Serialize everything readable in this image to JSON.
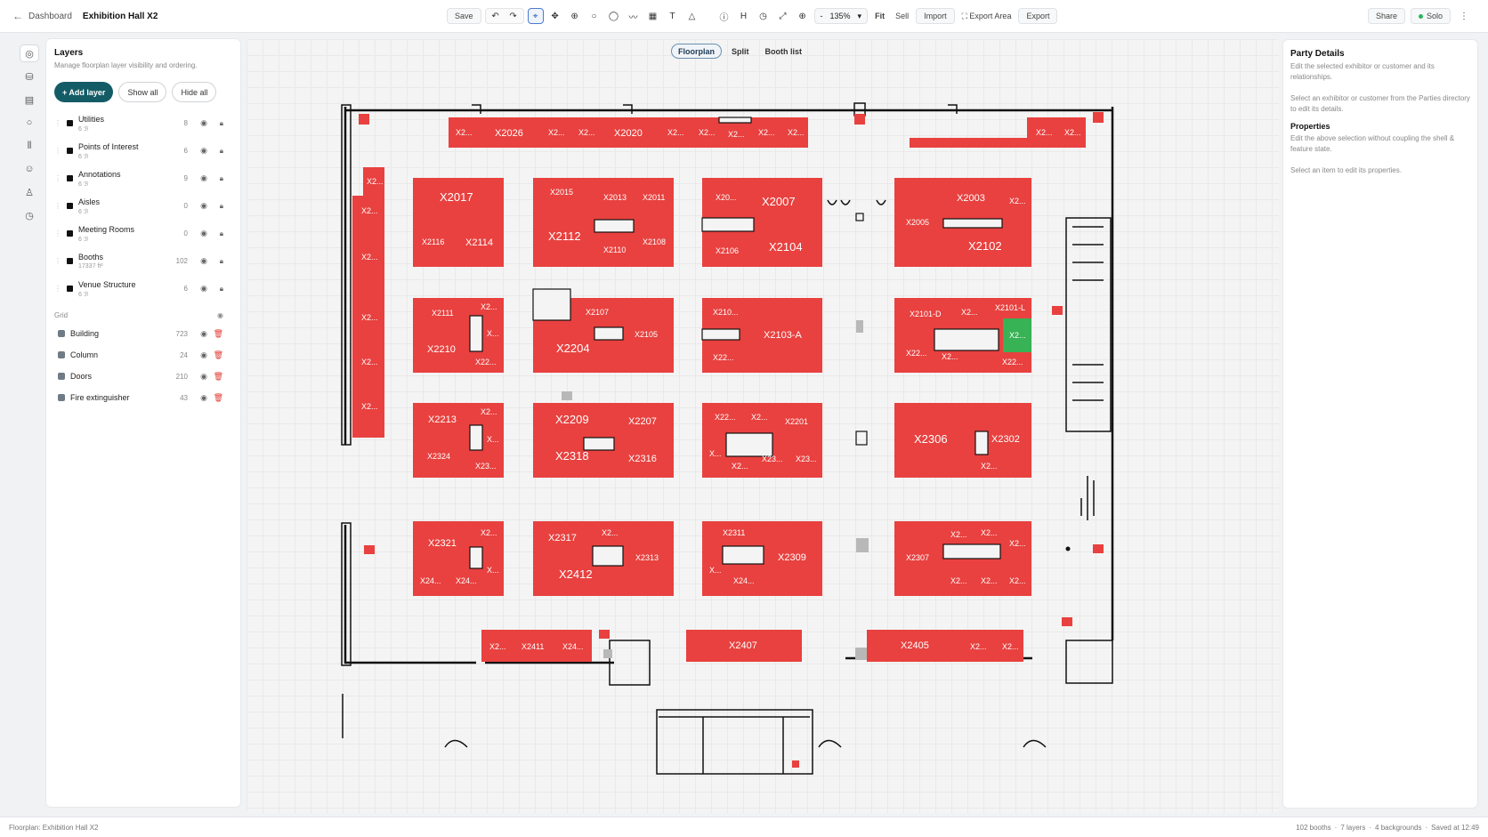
{
  "header": {
    "back_label": "Dashboard",
    "title": "Exhibition Hall X2",
    "save_label": "Save",
    "zoom_minus": "-",
    "zoom_value": "135%",
    "fit_label": "Fit",
    "sell_label": "Sell",
    "import_label": "Import",
    "export_area_label": "Export Area",
    "export_label": "Export",
    "share_label": "Share",
    "solo_label": "Solo"
  },
  "layers_panel": {
    "title": "Layers",
    "subtitle": "Manage floorplan layer visibility and ordering.",
    "add_label": "+ Add layer",
    "show_all_label": "Show all",
    "hide_all_label": "Hide all",
    "layers": [
      {
        "name": "Utilities",
        "meta": "6 ℬ",
        "count": "8"
      },
      {
        "name": "Points of Interest",
        "meta": "6 ℬ",
        "count": "6"
      },
      {
        "name": "Annotations",
        "meta": "6 ℬ",
        "count": "9"
      },
      {
        "name": "Aisles",
        "meta": "6 ℬ",
        "count": "0"
      },
      {
        "name": "Meeting Rooms",
        "meta": "6 ℬ",
        "count": "0"
      },
      {
        "name": "Booths",
        "meta": "17337 ft²",
        "count": "102"
      },
      {
        "name": "Venue Structure",
        "meta": "6 ℬ",
        "count": "6"
      }
    ],
    "grid_label": "Grid",
    "backgrounds": [
      {
        "name": "Building",
        "count": "723"
      },
      {
        "name": "Column",
        "count": "24"
      },
      {
        "name": "Doors",
        "count": "210"
      },
      {
        "name": "Fire extinguisher",
        "count": "43"
      }
    ]
  },
  "view_tabs": [
    "Floorplan",
    "Split",
    "Booth list"
  ],
  "booths": {
    "top_row": [
      "X2...",
      "X2026",
      "X2...",
      "X2...",
      "X2020",
      "X2...",
      "X2...",
      "X2...",
      "X2...",
      "X2...",
      "X2...",
      "X2..."
    ],
    "left_column": [
      "X2...",
      "X2...",
      "X2...",
      "X2...",
      "X2...",
      "X2..."
    ],
    "b1": [
      "X2017",
      "X2116",
      "X2114"
    ],
    "b2": [
      "X2015",
      "X2013",
      "X2011",
      "X2112",
      "X2110",
      "X2108"
    ],
    "b3": [
      "X20...",
      "X2007",
      "X2106",
      "X2104"
    ],
    "b4": [
      "X2003",
      "X2...",
      "X2005",
      "X2102"
    ],
    "b5": [
      "X2111",
      "X2...",
      "X...",
      "X2210",
      "X22..."
    ],
    "b6": [
      "X2107",
      "X2105",
      "X2204"
    ],
    "b7": [
      "X210...",
      "X2103-A",
      "X22..."
    ],
    "b8": [
      "X2101-D",
      "X2...",
      "X2101-L",
      "X2...",
      "X22...",
      "X2...",
      "X22..."
    ],
    "b9": [
      "X2213",
      "X2...",
      "X...",
      "X2324",
      "X23..."
    ],
    "b10": [
      "X2209",
      "X2207",
      "X2318",
      "X2316"
    ],
    "b11": [
      "X22...",
      "X2...",
      "X2201",
      "X...",
      "X2...",
      "X23...",
      "X23..."
    ],
    "b12": [
      "X2306",
      "X2302",
      "X2..."
    ],
    "b13": [
      "X2321",
      "X2...",
      "X...",
      "X24...",
      "X24..."
    ],
    "b14": [
      "X2317",
      "X2...",
      "X2313",
      "X2412"
    ],
    "b15": [
      "X2311",
      "X2309",
      "X...",
      "X24..."
    ],
    "b16": [
      "X2...",
      "X2...",
      "X2...",
      "X2307",
      "X2...",
      "X2...",
      "X2..."
    ],
    "bottom": [
      "X2...",
      "X2411",
      "X24...",
      "X2407",
      "X2405",
      "X2...",
      "X2..."
    ]
  },
  "right_panel": {
    "title": "Party Details",
    "desc": "Edit the selected exhibitor or customer and its relationships.",
    "hint": "Select an exhibitor or customer from the Parties directory to edit its details.",
    "props_title": "Properties",
    "props_desc": "Edit the above selection without coupling the shell & feature state.",
    "props_hint": "Select an item to edit its properties."
  },
  "status": {
    "left": "Floorplan: Exhibition Hall X2",
    "booths": "102 booths",
    "layers": "7 layers",
    "backgrounds": "4 backgrounds",
    "saved": "Saved at 12:49",
    "sep": "·"
  },
  "colors": {
    "booth": "#e8413f",
    "selected_booth": "#37b255",
    "primary": "#135c66"
  }
}
